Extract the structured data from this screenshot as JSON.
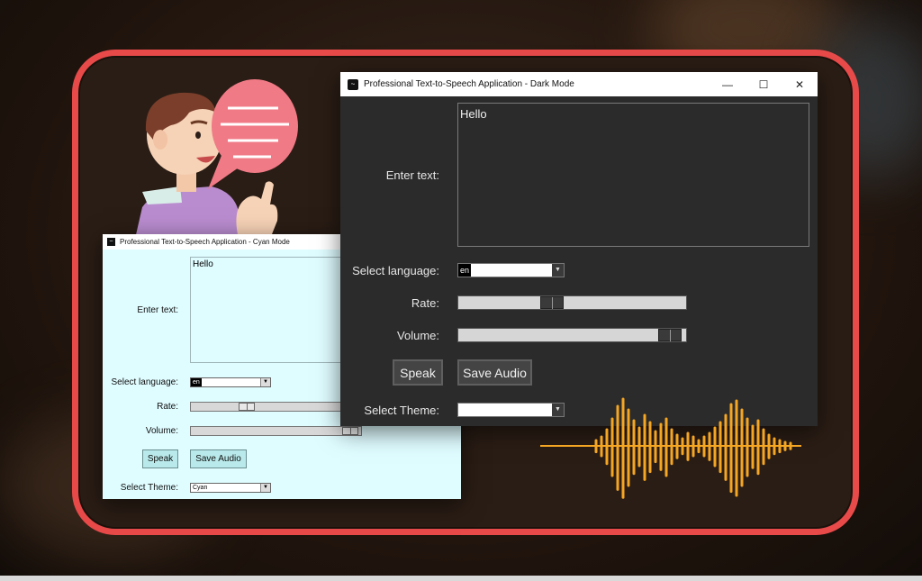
{
  "cyan_window": {
    "title": "Professional Text-to-Speech Application - Cyan Mode",
    "icon": "app-wave-icon",
    "enter_text_label": "Enter text:",
    "text_value": "Hello",
    "language_label": "Select language:",
    "language_value": "en",
    "rate_label": "Rate:",
    "rate_level": 0.35,
    "volume_label": "Volume:",
    "volume_level": 0.98,
    "speak_label": "Speak",
    "save_label": "Save Audio",
    "theme_label": "Select Theme:",
    "theme_value": "Cyan",
    "background": "#dffcff"
  },
  "dark_window": {
    "title": "Professional Text-to-Speech Application - Dark Mode",
    "icon": "app-wave-icon",
    "enter_text_label": "Enter text:",
    "text_value": "Hello",
    "language_label": "Select language:",
    "language_value": "en",
    "rate_label": "Rate:",
    "rate_level": 0.4,
    "volume_label": "Volume:",
    "volume_level": 0.98,
    "speak_label": "Speak",
    "save_label": "Save Audio",
    "theme_label": "Select Theme:",
    "theme_value": "",
    "window_controls": [
      "minimize-icon",
      "maximize-icon",
      "close-icon"
    ],
    "background": "#2b2b2b"
  },
  "colors": {
    "frame_accent": "#e84a4a",
    "wave_color": "#f5a623",
    "bubble_color": "#f07a86"
  }
}
